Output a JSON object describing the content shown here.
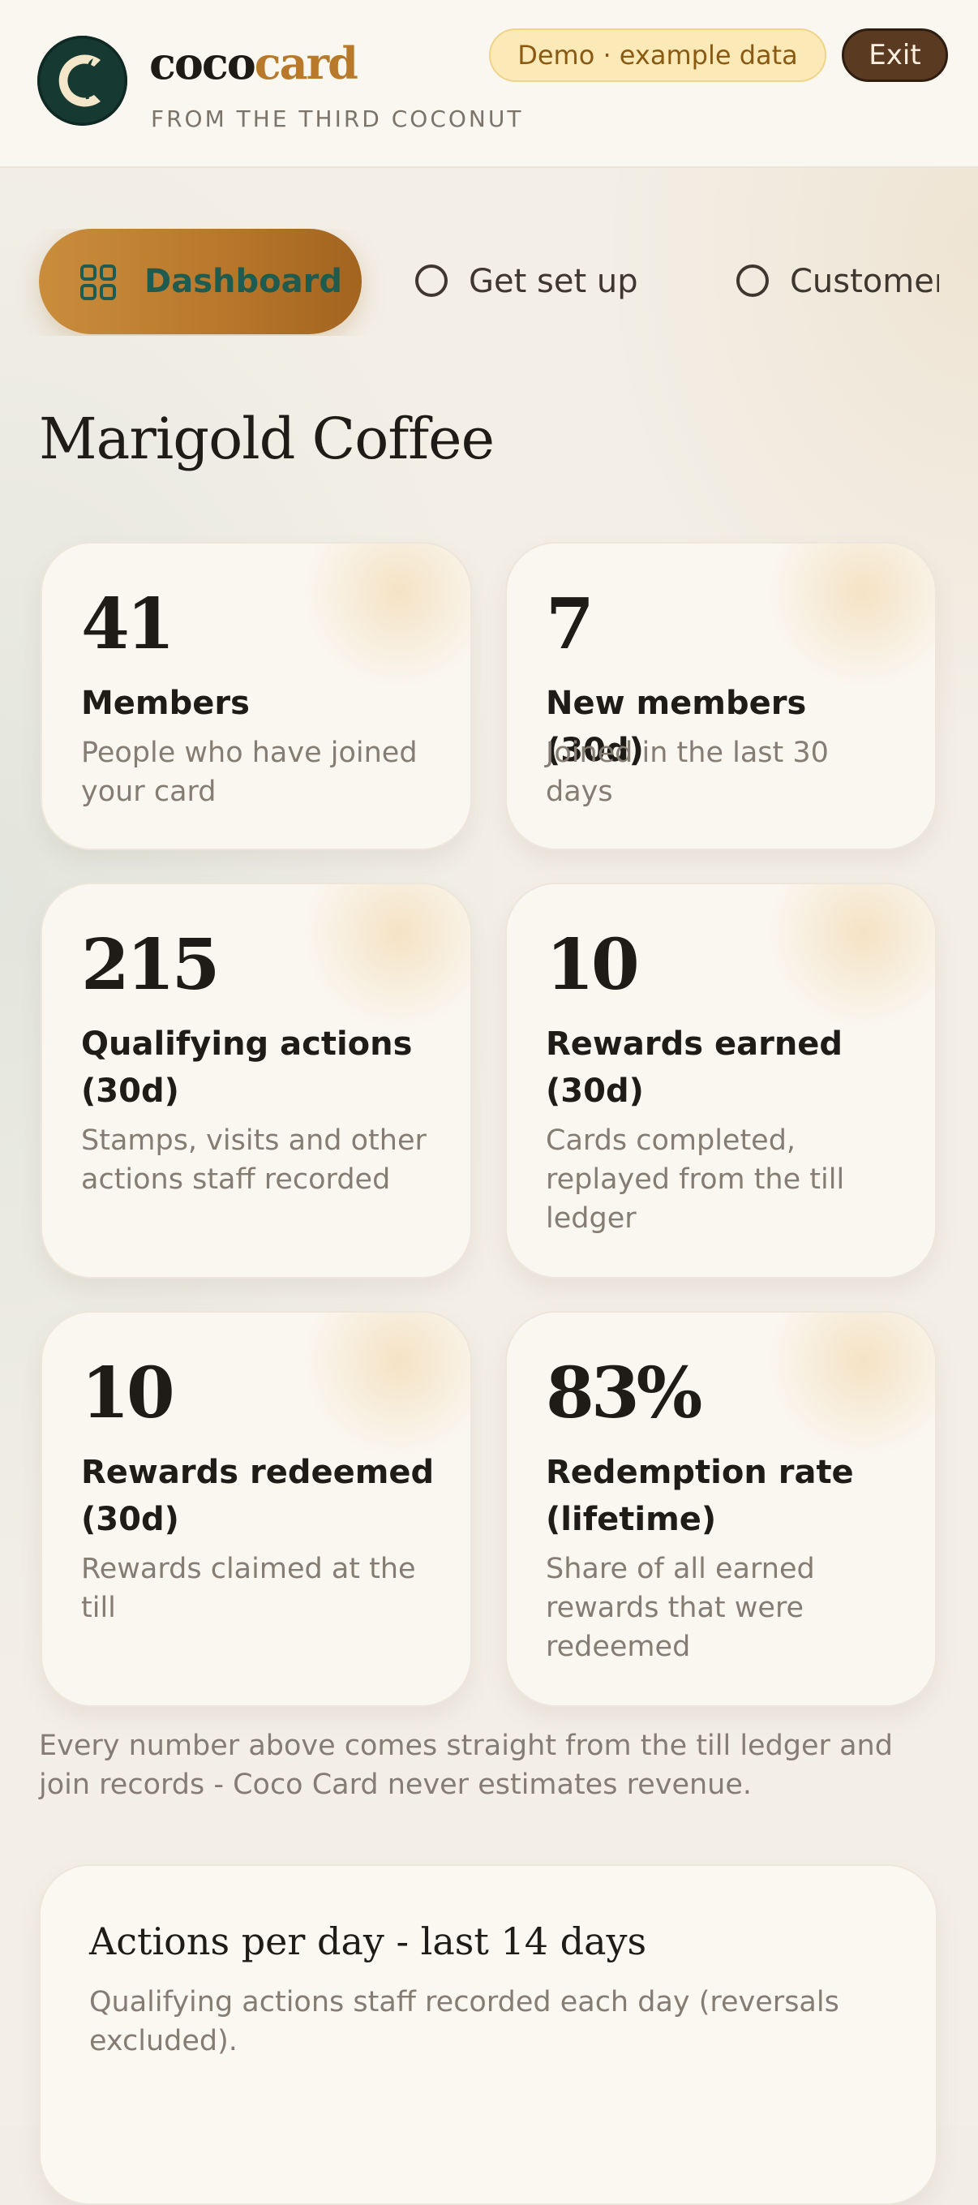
{
  "header": {
    "brand_part1": "coco",
    "brand_part2": "card",
    "tagline": "FROM THE THIRD COCONUT",
    "demo_badge": "Demo · example data",
    "exit_label": "Exit"
  },
  "tabs": [
    {
      "label": "Dashboard",
      "active": true,
      "icon": "grid-icon"
    },
    {
      "label": "Get set up",
      "active": false,
      "icon": "circle-icon"
    },
    {
      "label": "Customers",
      "active": false,
      "icon": "circle-icon"
    }
  ],
  "shop_name": "Marigold Coffee",
  "stats": [
    {
      "value": "41",
      "label": "Members",
      "description": "People who have joined your card"
    },
    {
      "value": "7",
      "label": "New members (30d)",
      "description": "Joined in the last 30 days"
    },
    {
      "value": "215",
      "label": "Qualifying actions (30d)",
      "description": "Stamps, visits and other actions staff recorded"
    },
    {
      "value": "10",
      "label": "Rewards earned (30d)",
      "description": "Cards completed, replayed from the till ledger"
    },
    {
      "value": "10",
      "label": "Rewards redeemed (30d)",
      "description": "Rewards claimed at the till"
    },
    {
      "value": "83%",
      "label": "Redemption rate (lifetime)",
      "description": "Share of all earned rewards that were redeemed"
    }
  ],
  "footnote": "Every number above comes straight from the till ledger and join records - Coco Card never estimates revenue.",
  "chart_panel": {
    "title": "Actions per day - last 14 days",
    "subtitle": "Qualifying actions staff recorded each day (reversals excluded)."
  },
  "colors": {
    "accent": "#b9792b",
    "brand_dark": "#163a32",
    "exit_bg": "#5b3a22",
    "demo_bg": "#fbe9b8"
  }
}
